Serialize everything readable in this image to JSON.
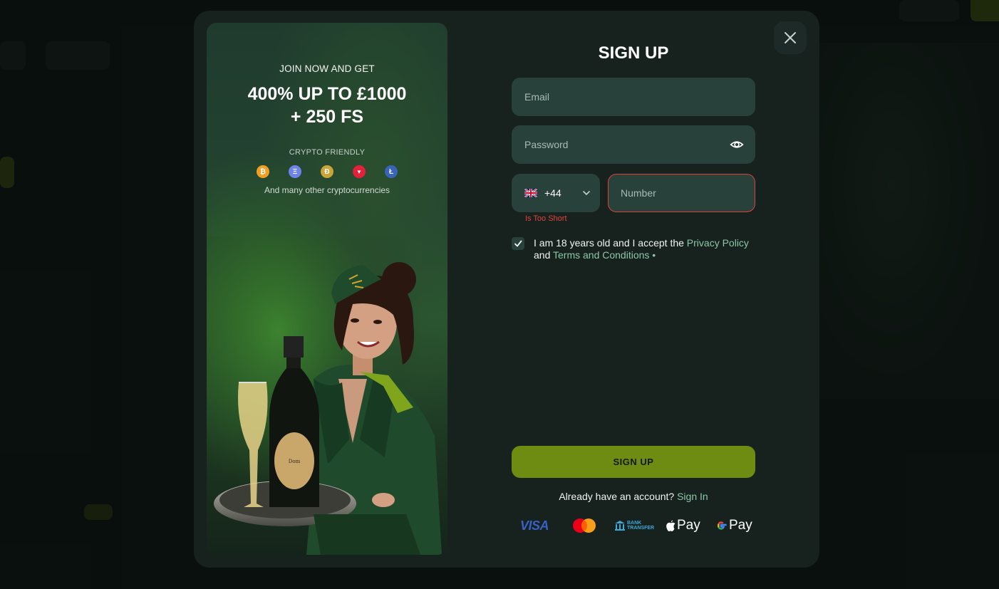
{
  "modal": {
    "promo": {
      "headline_small": "JOIN NOW AND GET",
      "offer_line1": "400% UP TO £1000",
      "offer_line2": "+ 250 FS",
      "crypto_label": "CRYPTO FRIENDLY",
      "crypto_coins": [
        {
          "icon": "bitcoin-icon",
          "glyph": "₿",
          "color": "#f2a023"
        },
        {
          "icon": "ethereum-icon",
          "glyph": "Ξ",
          "color": "#6f84e8"
        },
        {
          "icon": "dogecoin-icon",
          "glyph": "Ð",
          "color": "#c9a53a"
        },
        {
          "icon": "tron-icon",
          "glyph": "▼",
          "color": "#e4203b"
        },
        {
          "icon": "litecoin-icon",
          "glyph": "Ł",
          "color": "#3a64b8"
        }
      ],
      "crypto_more": "And many other cryptocurrencies"
    },
    "form": {
      "title": "SIGN UP",
      "email_placeholder": "Email",
      "password_placeholder": "Password",
      "phone_code": "+44",
      "number_placeholder": "Number",
      "number_error": "Is Too Short",
      "terms_text_before": "I am 18 years old and I accept the ",
      "privacy_link": "Privacy Policy",
      "terms_and": "and ",
      "terms_link": "Terms and Conditions",
      "terms_required": " •",
      "terms_checked": true,
      "submit_label": "SIGN UP",
      "already_text": "Already have an account? ",
      "signin_link": "Sign In"
    },
    "payments": {
      "visa": "VISA",
      "bank_line1": "BANK",
      "bank_line2": "TRANSFER",
      "apple_pay": "Pay",
      "google_pay": "Pay"
    }
  },
  "colors": {
    "accent_green": "#6e8c12",
    "link_green": "#8bc7a8",
    "error_red": "#e0453b",
    "field_bg": "#28413a",
    "modal_bg": "#17211e"
  }
}
